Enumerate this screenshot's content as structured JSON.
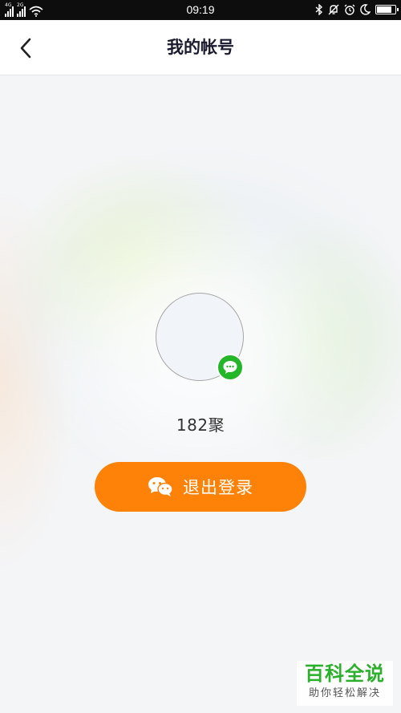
{
  "status_bar": {
    "time": "09:19",
    "network_1": "4G",
    "network_2": "2G",
    "battery_level": 0.85,
    "icons": [
      "signal-icon",
      "wifi-icon",
      "bluetooth-icon",
      "mute-bell-icon",
      "alarm-icon",
      "moon-icon",
      "battery-icon"
    ]
  },
  "nav": {
    "title": "我的帐号",
    "back_icon": "chevron-left-icon"
  },
  "profile": {
    "username": "182聚",
    "badge_icon": "wechat-bubble-icon"
  },
  "logout": {
    "label": "退出登录",
    "icon": "wechat-icon"
  },
  "colors": {
    "accent": "#ff8208",
    "wechat_green": "#22b628",
    "title_text": "#1a1a2e"
  },
  "watermark": {
    "main": "百科全说",
    "sub": "助你轻松解决"
  }
}
